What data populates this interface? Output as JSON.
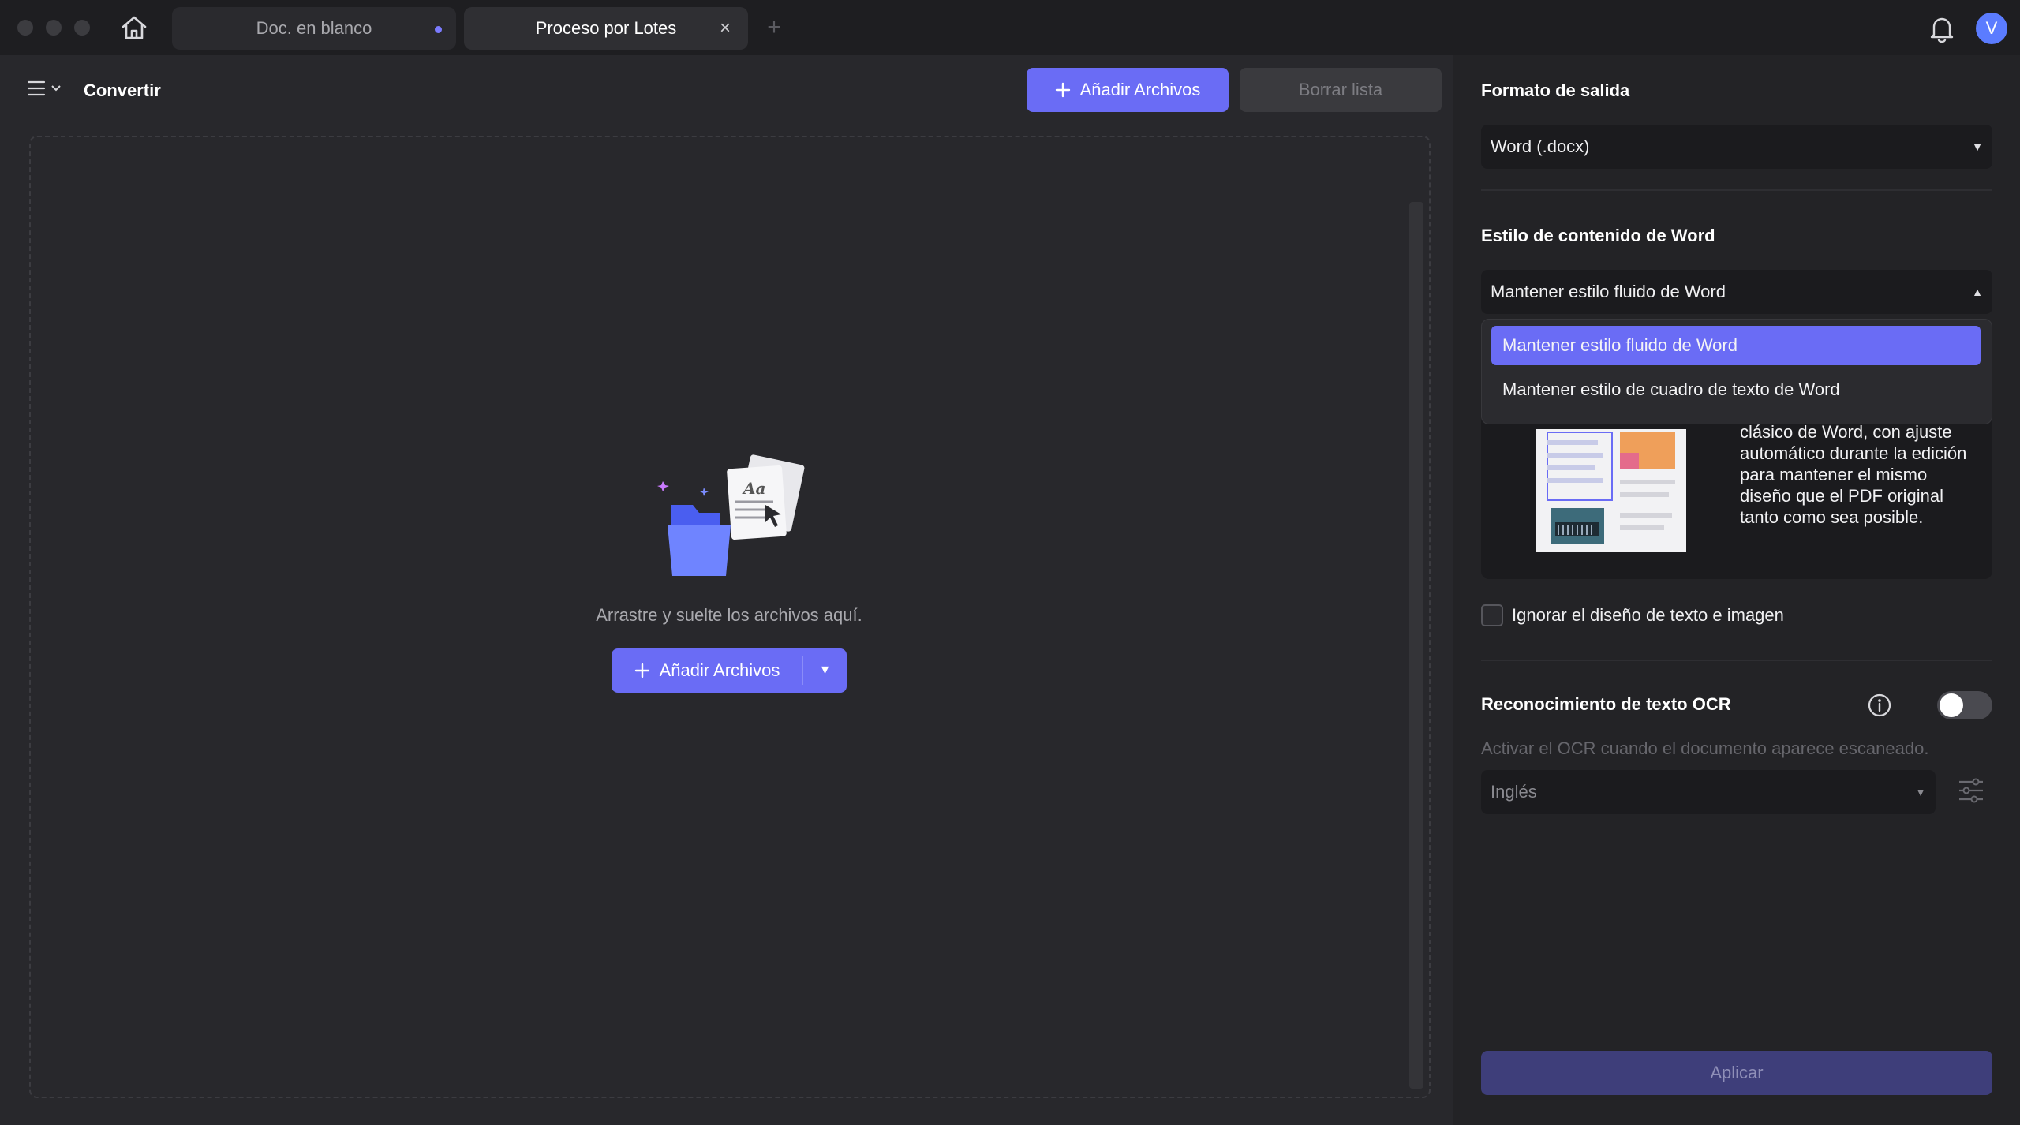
{
  "titlebar": {
    "tabs": [
      {
        "label": "Doc. en blanco"
      },
      {
        "label": "Proceso por Lotes"
      }
    ],
    "avatar_initial": "V"
  },
  "main": {
    "title": "Convertir",
    "add_files_label": "Añadir Archivos",
    "clear_list_label": "Borrar lista",
    "drop_text": "Arrastre y suelte los archivos aquí.",
    "center_add_label": "Añadir Archivos"
  },
  "panel": {
    "output_format_label": "Formato de salida",
    "output_format_value": "Word (.docx)",
    "word_style_label": "Estilo de contenido de Word",
    "word_style_value": "Mantener estilo fluido de Word",
    "word_style_options": [
      "Mantener estilo fluido de Word",
      "Mantener estilo de cuadro de texto de Word"
    ],
    "preview_text": "clásico de Word, con ajuste automático durante la edición para mantener el mismo diseño que el PDF original tanto como sea posible.",
    "ignore_layout_label": "Ignorar el diseño de texto e imagen",
    "ocr_label": "Reconocimiento de texto OCR",
    "ocr_enabled": false,
    "ocr_hint": "Activar el OCR cuando el documento aparece escaneado.",
    "ocr_language": "Inglés",
    "apply_label": "Aplicar"
  },
  "colors": {
    "accent": "#6a6cf5",
    "background": "#28282c",
    "panel": "#232326"
  }
}
